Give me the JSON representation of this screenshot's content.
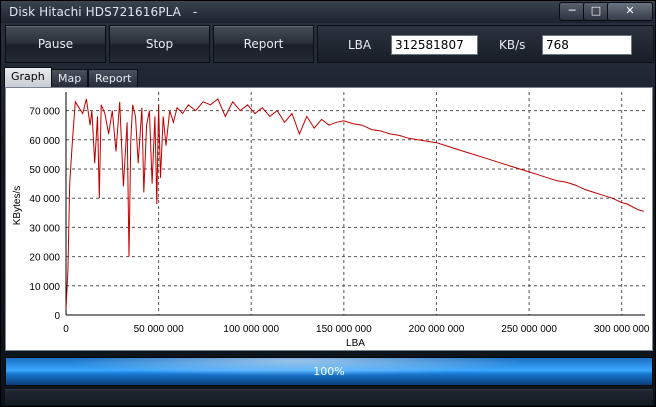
{
  "window": {
    "title": "Disk Hitachi HDS721616PLA",
    "title_suffix": "-"
  },
  "window_controls": {
    "minimize": "─",
    "maximize": "□",
    "close": "✕"
  },
  "toolbar": {
    "pause_label": "Pause",
    "stop_label": "Stop",
    "report_label": "Report"
  },
  "info": {
    "lba_label": "LBA",
    "lba_value": "312581807",
    "kbs_label": "KB/s",
    "kbs_value": "768"
  },
  "tabs": [
    {
      "label": "Graph",
      "active": true
    },
    {
      "label": "Map",
      "active": false
    },
    {
      "label": "Report",
      "active": false
    }
  ],
  "progress": {
    "value": 1.0,
    "text": "100%"
  },
  "chart_data": {
    "type": "line",
    "xlabel": "LBA",
    "ylabel": "KBytes/s",
    "xlim": [
      0,
      312581807
    ],
    "ylim": [
      0,
      75000
    ],
    "grid": true,
    "color": "#c00000",
    "x_ticks": [
      {
        "value": 0,
        "label": "0"
      },
      {
        "value": 50000000,
        "label": "50 000 000"
      },
      {
        "value": 100000000,
        "label": "100 000 000"
      },
      {
        "value": 150000000,
        "label": "150 000 000"
      },
      {
        "value": 200000000,
        "label": "200 000 000"
      },
      {
        "value": 250000000,
        "label": "250 000 000"
      },
      {
        "value": 300000000,
        "label": "300 000 000"
      }
    ],
    "y_ticks": [
      {
        "value": 0,
        "label": "0"
      },
      {
        "value": 10000,
        "label": "10 000"
      },
      {
        "value": 20000,
        "label": "20 000"
      },
      {
        "value": 30000,
        "label": "30 000"
      },
      {
        "value": 40000,
        "label": "40 000"
      },
      {
        "value": 50000,
        "label": "50 000"
      },
      {
        "value": 60000,
        "label": "60 000"
      },
      {
        "value": 70000,
        "label": "70 000"
      }
    ],
    "x": [
      0,
      1000000,
      2000000,
      3500000,
      5000000,
      7000000,
      9000000,
      11000000,
      13000000,
      14000000,
      15500000,
      17000000,
      18000000,
      19000000,
      21000000,
      23000000,
      25000000,
      27000000,
      29000000,
      31000000,
      33000000,
      34000000,
      35000000,
      36000000,
      37500000,
      39000000,
      41000000,
      42000000,
      43500000,
      45000000,
      46500000,
      48000000,
      49000000,
      50000000,
      51000000,
      52500000,
      54000000,
      56000000,
      58000000,
      60000000,
      63000000,
      66000000,
      70000000,
      74000000,
      78000000,
      82000000,
      86000000,
      90000000,
      94000000,
      98000000,
      102000000,
      106000000,
      110000000,
      114000000,
      118000000,
      122000000,
      126000000,
      130000000,
      134000000,
      138000000,
      142000000,
      146000000,
      150000000,
      155000000,
      160000000,
      165000000,
      170000000,
      175000000,
      180000000,
      185000000,
      190000000,
      195000000,
      200000000,
      205000000,
      210000000,
      215000000,
      220000000,
      225000000,
      230000000,
      235000000,
      240000000,
      245000000,
      250000000,
      255000000,
      260000000,
      265000000,
      270000000,
      275000000,
      280000000,
      285000000,
      290000000,
      295000000,
      300000000,
      303000000,
      306000000,
      309000000,
      312000000
    ],
    "y": [
      2000,
      15000,
      45000,
      60000,
      73000,
      71000,
      69000,
      74000,
      65000,
      70000,
      52000,
      68000,
      40000,
      72000,
      69000,
      62000,
      70000,
      56000,
      73000,
      44000,
      66000,
      20000,
      60000,
      72000,
      68000,
      52000,
      71000,
      42000,
      65000,
      70000,
      45000,
      68000,
      38000,
      72000,
      47000,
      68000,
      58000,
      70000,
      66000,
      71000,
      69000,
      72000,
      70000,
      73000,
      72000,
      74000,
      68000,
      73000,
      70000,
      72000,
      69000,
      71000,
      68000,
      70000,
      66000,
      69000,
      62000,
      68000,
      64000,
      67000,
      65000,
      66000,
      66500,
      65500,
      65000,
      63500,
      63000,
      62000,
      61500,
      60500,
      60000,
      59500,
      59000,
      58000,
      57000,
      56000,
      55000,
      54000,
      53000,
      52000,
      51000,
      50000,
      49000,
      48000,
      47000,
      46000,
      45500,
      44500,
      43000,
      42000,
      41000,
      40000,
      38500,
      38000,
      37000,
      36000,
      35500
    ]
  }
}
